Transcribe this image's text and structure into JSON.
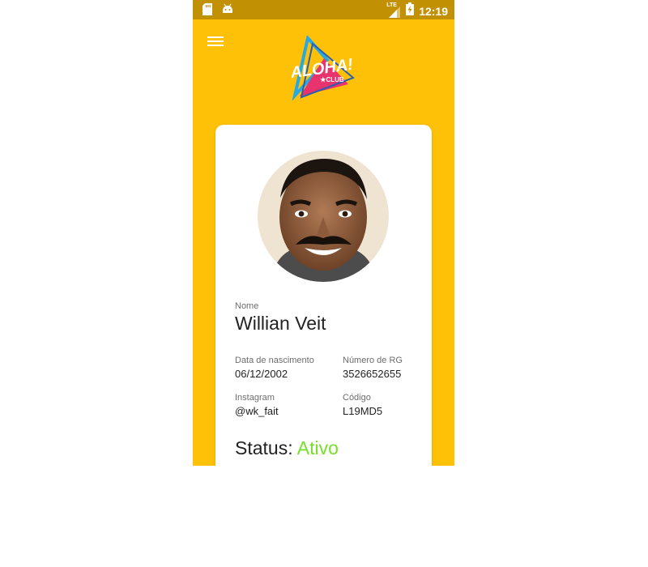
{
  "statusbar": {
    "time": "12:19",
    "network": "LTE",
    "icons": [
      "sdcard-icon",
      "android-icon",
      "signal-icon",
      "battery-charging-icon"
    ]
  },
  "header": {
    "logo_text": "ALOHA!",
    "logo_subtext": "CLUB",
    "menu_icon": "hamburger-menu-icon"
  },
  "profile": {
    "photo_icon": "profile-photo",
    "name_label": "Nome",
    "name": "Willian Veit",
    "birth_label": "Data de nascimento",
    "birth": "06/12/2002",
    "rg_label": "Número de RG",
    "rg": "3526652655",
    "instagram_label": "Instagram",
    "instagram": "@wk_fait",
    "code_label": "Código",
    "code": "L19MD5",
    "status_label": "Status:",
    "status_value": "Ativo"
  },
  "colors": {
    "background": "#ffc107",
    "statusbar": "#c29103",
    "status_active": "#76e02a",
    "card": "#ffffff"
  }
}
